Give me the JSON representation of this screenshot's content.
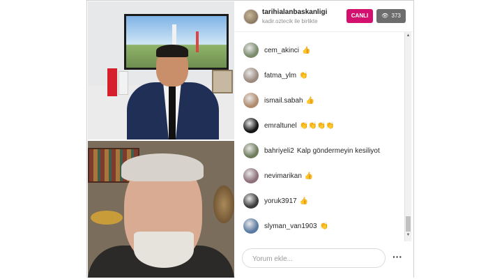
{
  "stream": {
    "host_username": "tarihialanbaskanligi",
    "host_subtitle": "kadir.oztecik ile birlikte",
    "live_label": "CANLI",
    "viewer_count": "373"
  },
  "comments": [
    {
      "user": "cem_akinci",
      "text": "👍",
      "avatar_color": "#7a8a6a"
    },
    {
      "user": "fatma_ylm",
      "text": "👏",
      "avatar_color": "#9c8a7e"
    },
    {
      "user": "ismail.sabah",
      "text": "👍",
      "avatar_color": "#b08a6c"
    },
    {
      "user": "emraltunel",
      "text": "👏👏👏👏",
      "avatar_color": "#141414"
    },
    {
      "user": "bahriyeli2",
      "text": "Kalp göndermeyin kesiliyot",
      "avatar_color": "#6e7c5b"
    },
    {
      "user": "nevimarikan",
      "text": "👍",
      "avatar_color": "#8d6f7a"
    },
    {
      "user": "yoruk3917",
      "text": "👍",
      "avatar_color": "#3b3b3b"
    },
    {
      "user": "slyman_van1903",
      "text": "👏",
      "avatar_color": "#5a7aa3"
    }
  ],
  "composer": {
    "placeholder": "Yorum ekle..."
  },
  "colors": {
    "live_badge": "#d3106e",
    "viewer_badge": "#6d6d6d"
  }
}
